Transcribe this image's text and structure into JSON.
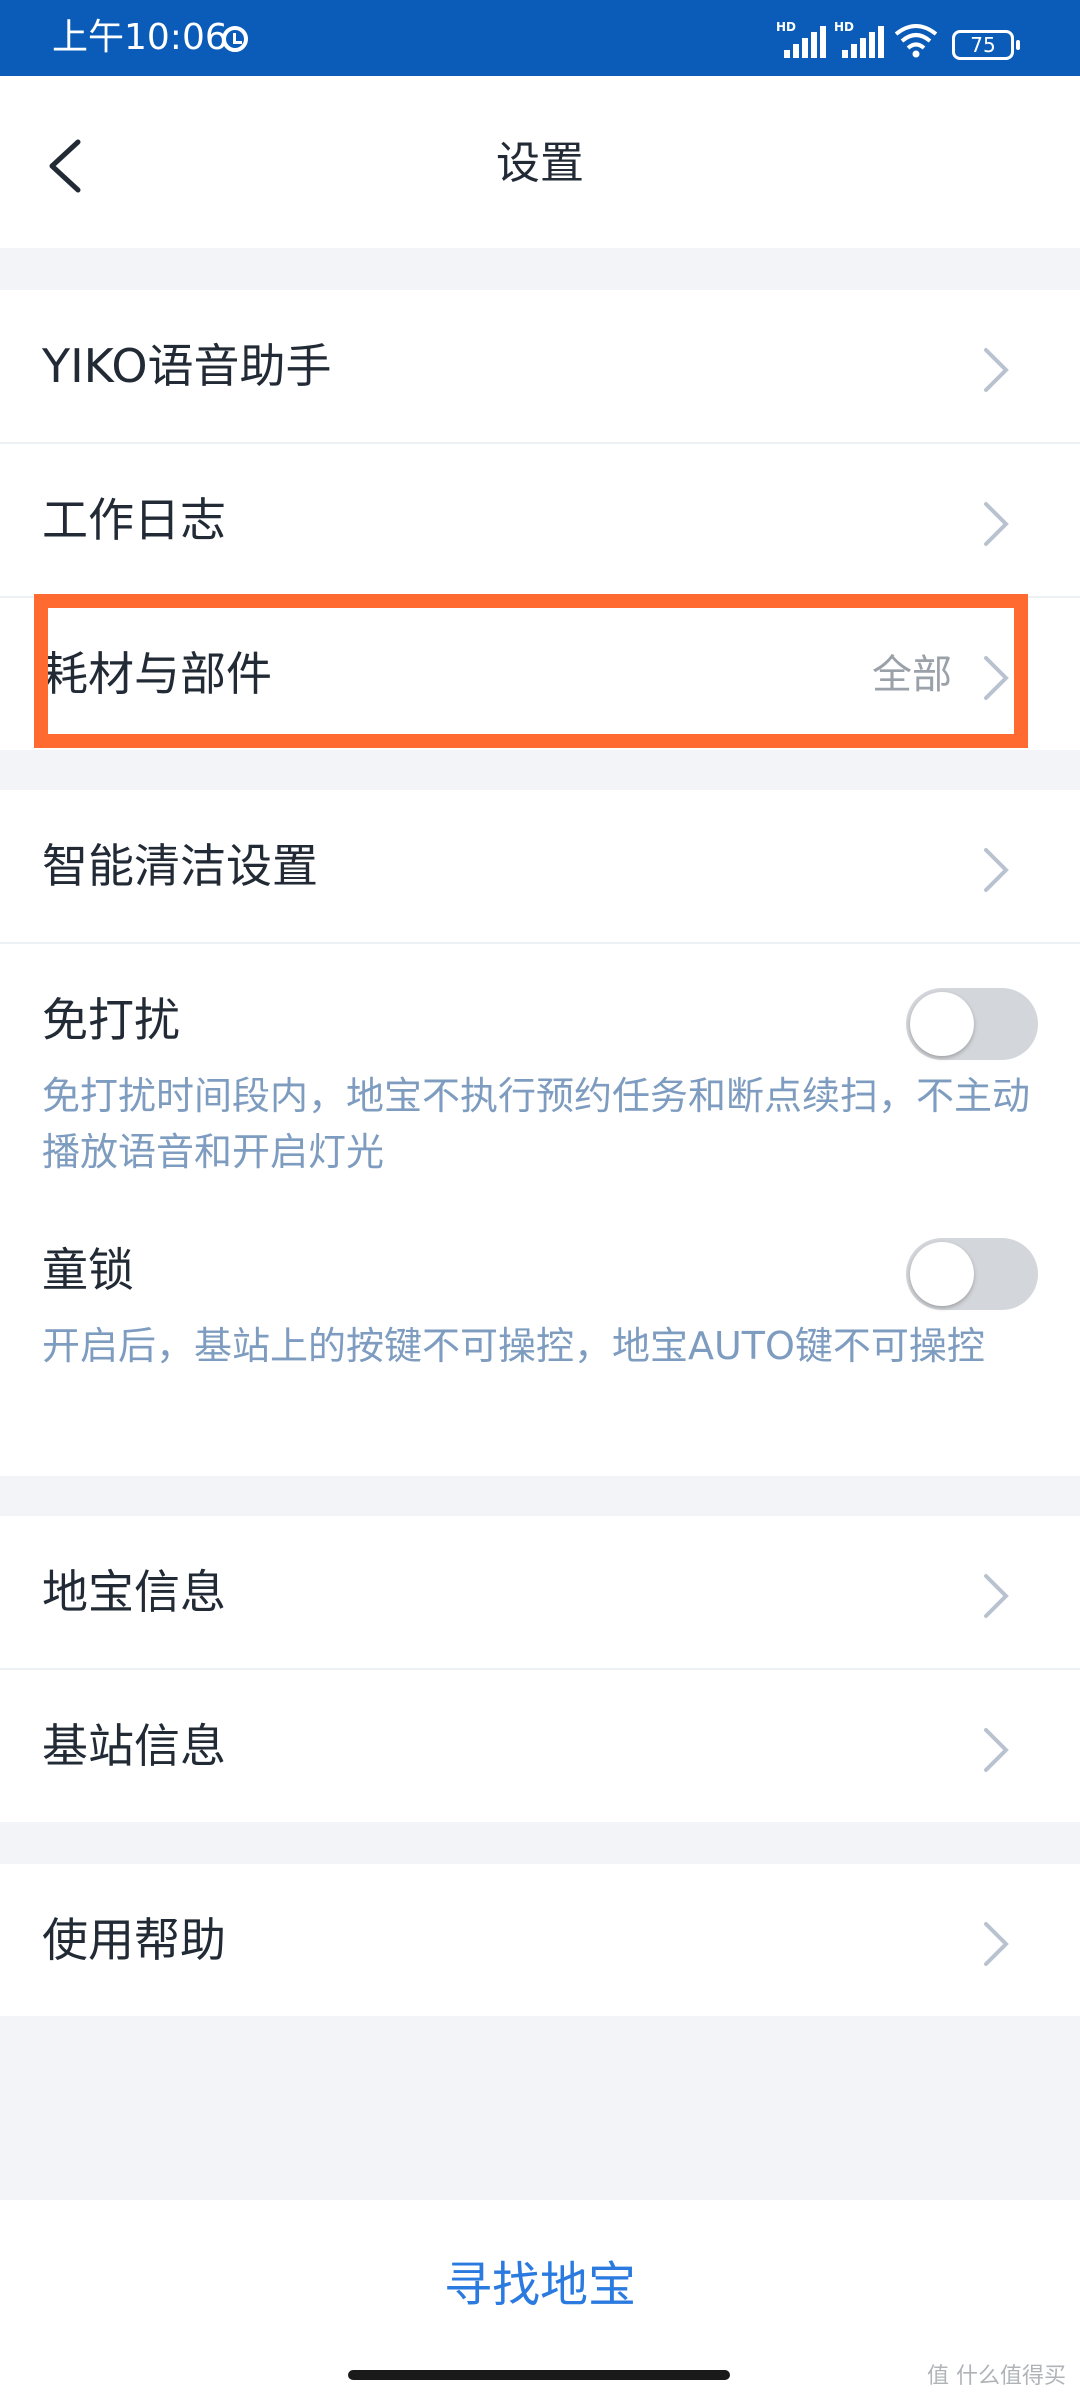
{
  "status_bar": {
    "time": "上午10:06",
    "signal_label": "HD",
    "battery": "75"
  },
  "header": {
    "title": "设置"
  },
  "group1": {
    "items": [
      {
        "label": "YIKO语音助手"
      },
      {
        "label": "工作日志"
      },
      {
        "label": "耗材与部件",
        "value": "全部"
      }
    ]
  },
  "group2": {
    "smart_clean": "智能清洁设置",
    "dnd": {
      "label": "免打扰",
      "desc": "免打扰时间段内，地宝不执行预约任务和断点续扫，不主动播放语音和开启灯光",
      "enabled": false
    },
    "child_lock": {
      "label": "童锁",
      "desc": "开启后，基站上的按键不可操控，地宝AUTO键不可操控",
      "enabled": false
    }
  },
  "group3": {
    "items": [
      {
        "label": "地宝信息"
      },
      {
        "label": "基站信息"
      }
    ]
  },
  "group4": {
    "items": [
      {
        "label": "使用帮助"
      }
    ]
  },
  "bottom": {
    "find_button": "寻找地宝"
  },
  "watermark": "值 什么值得买",
  "colors": {
    "status_bar": "#0a5cb8",
    "highlight": "#ff6a30",
    "accent": "#2a7ae0",
    "desc_text": "#7d9cbf"
  }
}
